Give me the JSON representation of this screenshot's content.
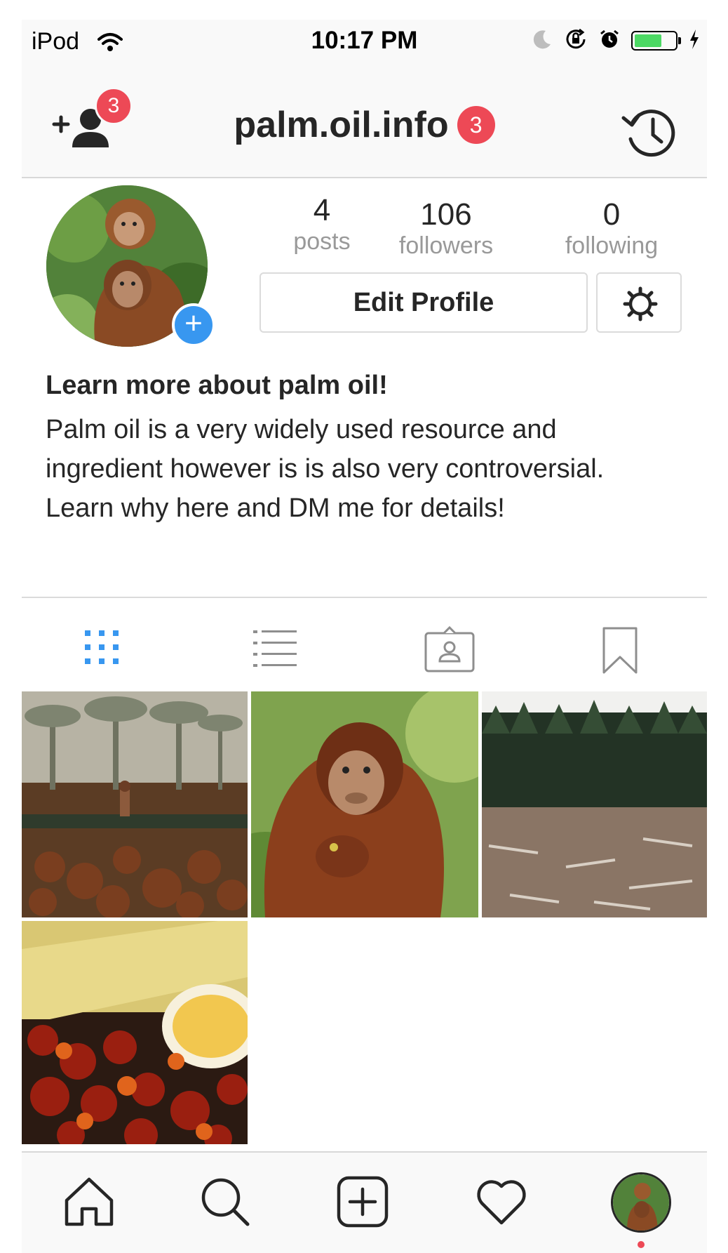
{
  "status_bar": {
    "carrier": "iPod",
    "time": "10:17 PM",
    "icons": [
      "wifi-icon",
      "moon-icon",
      "rotation-lock-icon",
      "alarm-icon",
      "battery-icon",
      "charging-icon"
    ],
    "battery_level": 0.65,
    "battery_color": "#4cd964"
  },
  "header": {
    "username": "palm.oil.info",
    "username_badge": "3",
    "add_people_badge": "3",
    "left_icon": "add-person-icon",
    "right_icon": "history-icon"
  },
  "profile": {
    "stats": [
      {
        "value": "4",
        "label": "posts"
      },
      {
        "value": "106",
        "label": "followers"
      },
      {
        "value": "0",
        "label": "following"
      }
    ],
    "edit_profile_label": "Edit Profile",
    "settings_icon": "gear-icon",
    "bio_title": "Learn more about palm oil!",
    "bio_text": "Palm oil is a very widely used resource and ingredient however is is also very controversial. Learn why here and DM me for details!"
  },
  "tabs": [
    {
      "name": "grid-view",
      "icon": "grid-icon",
      "active": true
    },
    {
      "name": "list-view",
      "icon": "list-icon",
      "active": false
    },
    {
      "name": "tagged",
      "icon": "tagged-person-icon",
      "active": false
    },
    {
      "name": "saved",
      "icon": "bookmark-icon",
      "active": false
    }
  ],
  "posts": [
    {
      "subject": "palm-plantation-harvest"
    },
    {
      "subject": "orangutan"
    },
    {
      "subject": "cleared-forest"
    },
    {
      "subject": "palm-oil-and-fruit"
    }
  ],
  "bottom_nav": [
    {
      "name": "home",
      "icon": "home-icon"
    },
    {
      "name": "search",
      "icon": "search-icon"
    },
    {
      "name": "new-post",
      "icon": "plus-square-icon"
    },
    {
      "name": "activity",
      "icon": "heart-icon"
    },
    {
      "name": "profile",
      "icon": "profile-avatar"
    }
  ],
  "colors": {
    "accent": "#3897f0",
    "badge": "#ed4956",
    "text": "#262626",
    "muted": "#999999",
    "border": "#dbdbdb"
  }
}
